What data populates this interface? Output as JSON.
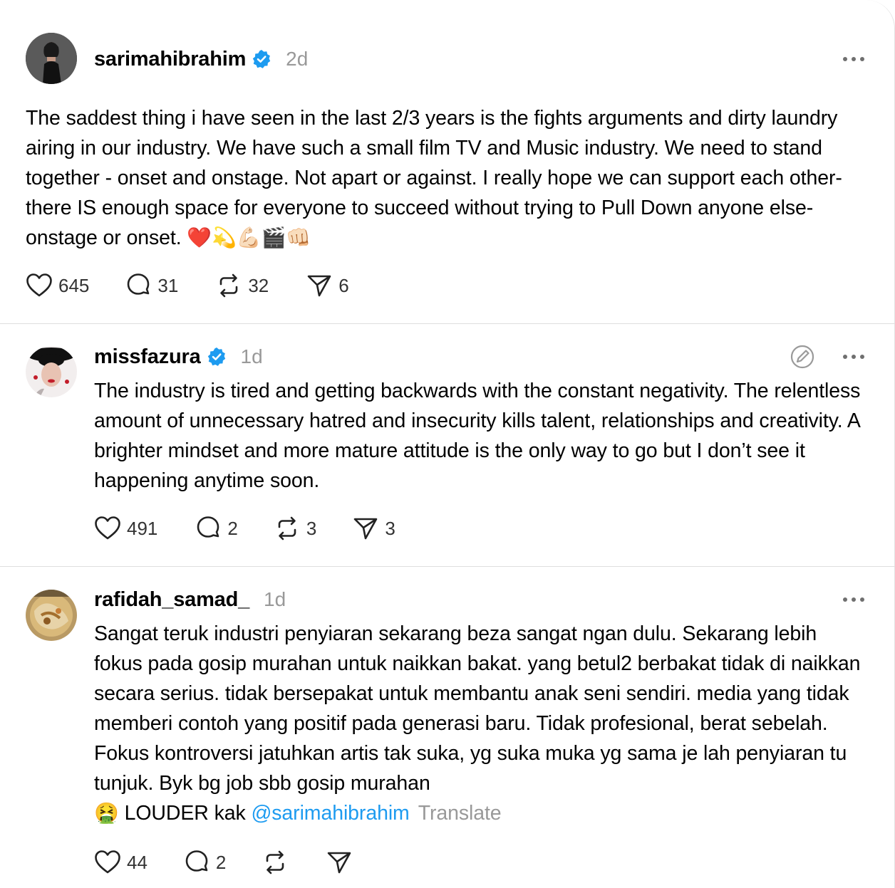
{
  "posts": [
    {
      "username": "sarimahibrahim",
      "verified": true,
      "time": "2d",
      "text": "The saddest thing i have seen in the last 2/3 years is the fights arguments and dirty laundry airing in our industry. We have such a small film TV and Music industry. We need to stand together - onset and onstage. Not apart or against. I really hope we can support each other- there IS enough space for everyone to succeed without trying to Pull Down anyone else- onstage or onset.",
      "emoji": "❤️💫💪🏻🎬👊🏻",
      "likes": "645",
      "replies": "31",
      "reposts": "32",
      "shares": "6"
    },
    {
      "username": "missfazura",
      "verified": true,
      "time": "1d",
      "text": "The industry is tired and getting backwards with the constant negativity. The relentless amount of unnecessary hatred and insecurity kills talent, relationships and creativity. A brighter mindset and more mature attitude is the only way to go but I don’t see it happening anytime soon.",
      "likes": "491",
      "replies": "2",
      "reposts": "3",
      "shares": "3"
    },
    {
      "username": "rafidah_samad_",
      "verified": false,
      "time": "1d",
      "text": "Sangat teruk industri penyiaran sekarang beza sangat ngan dulu. Sekarang lebih fokus pada gosip murahan untuk naikkan bakat. yang betul2 berbakat tidak di naikkan secara serius. tidak bersepakat untuk membantu anak seni sendiri. media yang tidak memberi contoh yang positif pada generasi baru. Tidak profesional, berat sebelah. Fokus kontroversi jatuhkan artis tak suka, yg suka muka yg sama je lah penyiaran tu tunjuk. Byk bg job sbb gosip murahan",
      "emoji": "🤮",
      "tail": " LOUDER kak ",
      "mention": "@sarimahibrahim",
      "translate": "Translate",
      "likes": "44",
      "replies": "2"
    }
  ],
  "colors": {
    "verified": "#1d9bf0",
    "muted": "#999999",
    "mention": "#1d9bf0"
  },
  "icons": [
    "heart-icon",
    "reply-icon",
    "repost-icon",
    "share-icon",
    "more-icon",
    "verified-icon",
    "edit-icon"
  ]
}
